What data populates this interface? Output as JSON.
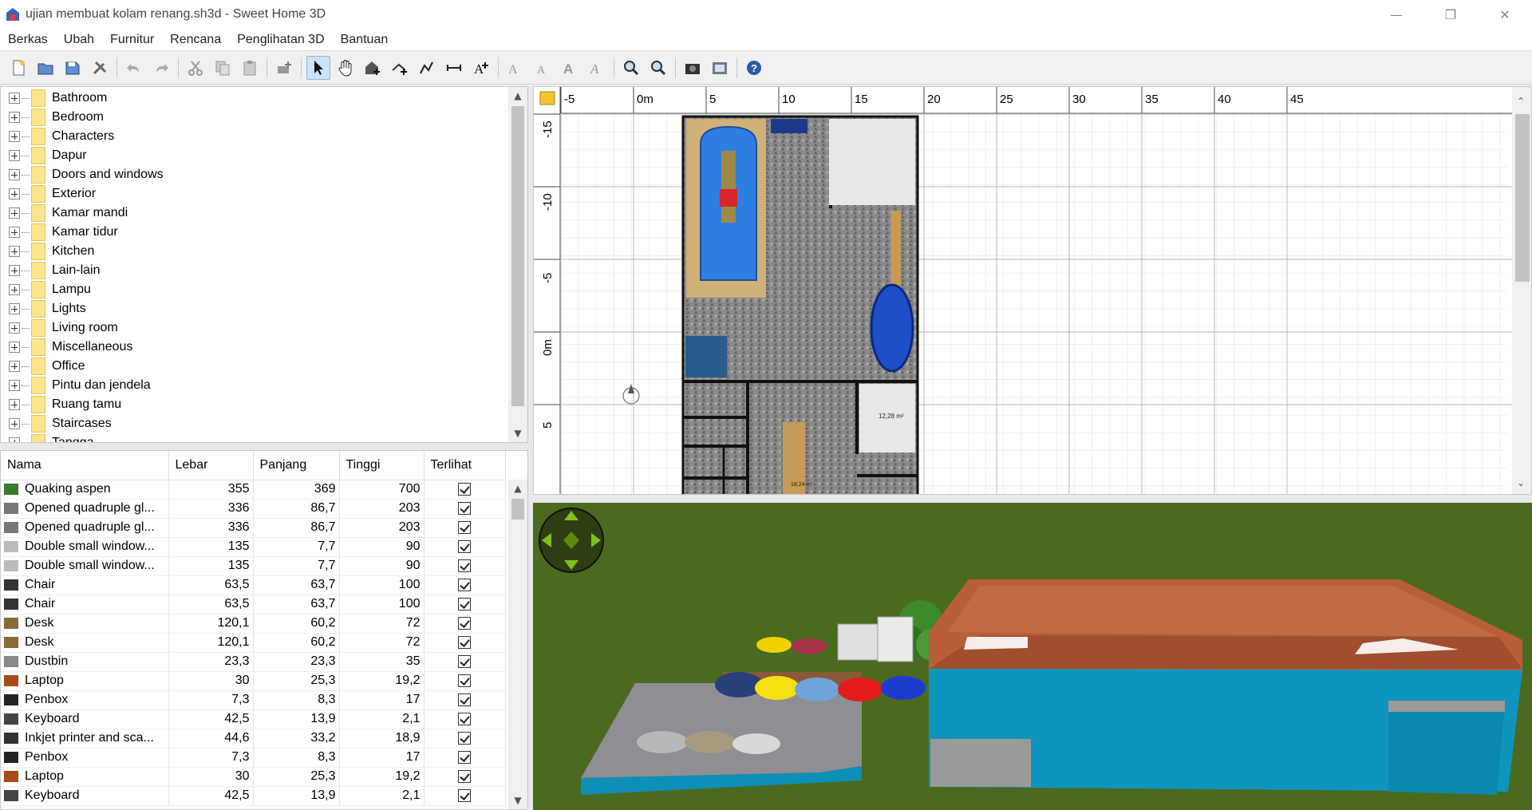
{
  "window": {
    "title": "ujian membuat kolam renang.sh3d - Sweet Home 3D",
    "controls": [
      "minimize",
      "restore",
      "close"
    ]
  },
  "menu": [
    "Berkas",
    "Ubah",
    "Furnitur",
    "Rencana",
    "Penglihatan 3D",
    "Bantuan"
  ],
  "toolbar": {
    "icons": [
      "new-icon",
      "open-icon",
      "save-icon",
      "preferences-icon",
      "undo-icon",
      "redo-icon",
      "cut-icon",
      "copy-icon",
      "paste-icon",
      "add-furniture-icon",
      "select-mode-icon",
      "pan-mode-icon",
      "create-walls-icon",
      "create-rooms-icon",
      "create-polylines-icon",
      "create-dimensions-icon",
      "add-text-icon",
      "increase-text-icon",
      "decrease-text-icon",
      "bold-text-icon",
      "italic-text-icon",
      "zoom-in-icon",
      "zoom-out-icon",
      "create-photo-icon",
      "create-video-icon",
      "help-icon"
    ]
  },
  "catalog": {
    "categories": [
      "Bathroom",
      "Bedroom",
      "Characters",
      "Dapur",
      "Doors and windows",
      "Exterior",
      "Kamar mandi",
      "Kamar tidur",
      "Kitchen",
      "Lain-lain",
      "Lampu",
      "Lights",
      "Living room",
      "Miscellaneous",
      "Office",
      "Pintu dan jendela",
      "Ruang tamu",
      "Staircases",
      "Tangga"
    ]
  },
  "furniture": {
    "columns": [
      "Nama",
      "Lebar",
      "Panjang",
      "Tinggi",
      "Terlihat"
    ],
    "rows": [
      {
        "name": "Quaking aspen",
        "w": "355",
        "d": "369",
        "h": "700",
        "icon": "tree-icon"
      },
      {
        "name": "Opened quadruple gl...",
        "w": "336",
        "d": "86,7",
        "h": "203",
        "icon": "door-icon"
      },
      {
        "name": "Opened quadruple gl...",
        "w": "336",
        "d": "86,7",
        "h": "203",
        "icon": "door-icon"
      },
      {
        "name": "Double small window...",
        "w": "135",
        "d": "7,7",
        "h": "90",
        "icon": "window-icon"
      },
      {
        "name": "Double small window...",
        "w": "135",
        "d": "7,7",
        "h": "90",
        "icon": "window-icon"
      },
      {
        "name": "Chair",
        "w": "63,5",
        "d": "63,7",
        "h": "100",
        "icon": "chair-icon"
      },
      {
        "name": "Chair",
        "w": "63,5",
        "d": "63,7",
        "h": "100",
        "icon": "chair-icon"
      },
      {
        "name": "Desk",
        "w": "120,1",
        "d": "60,2",
        "h": "72",
        "icon": "desk-icon"
      },
      {
        "name": "Desk",
        "w": "120,1",
        "d": "60,2",
        "h": "72",
        "icon": "desk-icon"
      },
      {
        "name": "Dustbin",
        "w": "23,3",
        "d": "23,3",
        "h": "35",
        "icon": "dustbin-icon"
      },
      {
        "name": "Laptop",
        "w": "30",
        "d": "25,3",
        "h": "19,2",
        "icon": "laptop-icon"
      },
      {
        "name": "Penbox",
        "w": "7,3",
        "d": "8,3",
        "h": "17",
        "icon": "penbox-icon"
      },
      {
        "name": "Keyboard",
        "w": "42,5",
        "d": "13,9",
        "h": "2,1",
        "icon": "keyboard-icon"
      },
      {
        "name": "Inkjet printer and sca...",
        "w": "44,6",
        "d": "33,2",
        "h": "18,9",
        "icon": "printer-icon"
      },
      {
        "name": "Penbox",
        "w": "7,3",
        "d": "8,3",
        "h": "17",
        "icon": "penbox-icon"
      },
      {
        "name": "Laptop",
        "w": "30",
        "d": "25,3",
        "h": "19,2",
        "icon": "laptop-icon"
      },
      {
        "name": "Keyboard",
        "w": "42,5",
        "d": "13,9",
        "h": "2,1",
        "icon": "keyboard-icon"
      }
    ]
  },
  "plan": {
    "ruler_x": [
      "-5",
      "0m",
      "5",
      "10",
      "15",
      "20",
      "25",
      "30",
      "35",
      "40",
      "45"
    ],
    "ruler_y": [
      "-15",
      "-10",
      "-5",
      "0m",
      "5"
    ],
    "room_labels": [
      "12,28 m²",
      "18,24 m²"
    ]
  }
}
